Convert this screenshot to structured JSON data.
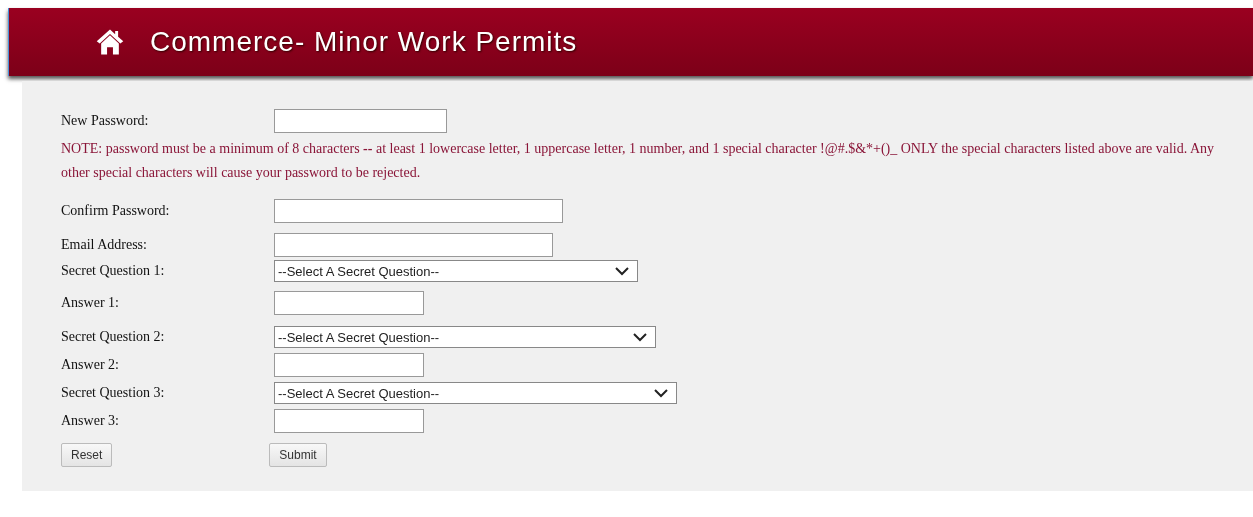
{
  "header": {
    "title": "Commerce- Minor Work Permits"
  },
  "form": {
    "rows": [
      {
        "kind": "text",
        "label": "New Password:",
        "value": ""
      },
      {
        "kind": "note",
        "text": "NOTE:  password must be a minimum of 8 characters **--** at least 1 lowercase letter, 1 uppercase letter, 1 number, and 1 special character !@#.$&*+()_ ONLY the special characters listed above are valid. Any other special characters will cause your password to be rejected."
      },
      {
        "kind": "text",
        "label": "Confirm Password:",
        "value": ""
      },
      {
        "kind": "text",
        "label": "Email Address:",
        "value": ""
      },
      {
        "kind": "select",
        "label": "Secret Question 1:",
        "value": "--Select A Secret Question--"
      },
      {
        "kind": "text",
        "label": "Answer 1:",
        "value": ""
      },
      {
        "kind": "select",
        "label": "Secret Question 2:",
        "value": "--Select A Secret Question--"
      },
      {
        "kind": "text",
        "label": "Answer 2:",
        "value": ""
      },
      {
        "kind": "select",
        "label": "Secret Question 3:",
        "value": "--Select A Secret Question--"
      },
      {
        "kind": "text",
        "label": "Answer 3:",
        "value": ""
      }
    ],
    "buttons": [
      "Reset",
      "Submit"
    ]
  }
}
